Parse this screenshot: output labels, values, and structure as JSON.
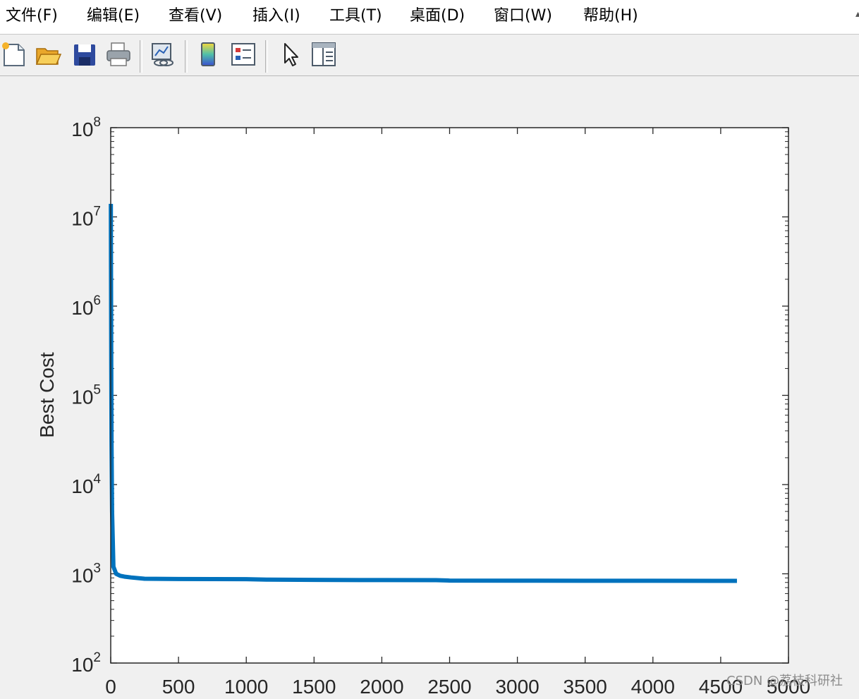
{
  "menu": {
    "items": [
      {
        "label": "文件(F)",
        "name": "menu-file"
      },
      {
        "label": "编辑(E)",
        "name": "menu-edit"
      },
      {
        "label": "查看(V)",
        "name": "menu-view"
      },
      {
        "label": "插入(I)",
        "name": "menu-insert"
      },
      {
        "label": "工具(T)",
        "name": "menu-tools"
      },
      {
        "label": "桌面(D)",
        "name": "menu-desktop"
      },
      {
        "label": "窗口(W)",
        "name": "menu-window"
      },
      {
        "label": "帮助(H)",
        "name": "menu-help"
      }
    ]
  },
  "toolbar": {
    "buttons": [
      {
        "icon": "new-figure-icon"
      },
      {
        "icon": "open-file-icon"
      },
      {
        "icon": "save-icon"
      },
      {
        "icon": "print-icon"
      },
      {
        "icon": "link-plot-icon"
      },
      {
        "icon": "colorbar-icon"
      },
      {
        "icon": "legend-icon"
      },
      {
        "icon": "edit-plot-arrow-icon"
      },
      {
        "icon": "property-inspector-icon"
      }
    ]
  },
  "chart_data": {
    "type": "line",
    "title": "",
    "xlabel": "",
    "ylabel": "Best Cost",
    "yscale": "log",
    "xlim": [
      0,
      5000
    ],
    "ylim": [
      100,
      100000000
    ],
    "xticks": [
      0,
      500,
      1000,
      1500,
      2000,
      2500,
      3000,
      3500,
      4000,
      4500,
      5000
    ],
    "xtick_labels": [
      "0",
      "500",
      "1000",
      "1500",
      "2000",
      "2500",
      "3000",
      "3500",
      "4000",
      "4500",
      "5000"
    ],
    "yticks": [
      100,
      1000,
      10000,
      100000,
      1000000,
      10000000,
      100000000
    ],
    "ytick_labels": [
      {
        "base": "10",
        "exp": "2"
      },
      {
        "base": "10",
        "exp": "3"
      },
      {
        "base": "10",
        "exp": "4"
      },
      {
        "base": "10",
        "exp": "5"
      },
      {
        "base": "10",
        "exp": "6"
      },
      {
        "base": "10",
        "exp": "7"
      },
      {
        "base": "10",
        "exp": "8"
      }
    ],
    "grid": false,
    "series": [
      {
        "color": "#0072bd",
        "x": [
          1,
          2,
          4,
          6,
          10,
          20,
          40,
          70,
          100,
          150,
          250,
          500,
          1000,
          1150,
          1500,
          2000,
          2400,
          2500,
          3000,
          3500,
          4000,
          4620
        ],
        "y": [
          14000000,
          3000000,
          200000,
          30000,
          5000,
          1200,
          1000,
          950,
          930,
          910,
          880,
          875,
          870,
          860,
          855,
          850,
          848,
          840,
          838,
          836,
          835,
          833
        ]
      }
    ]
  },
  "watermark": "CSDN @荔枝科研社"
}
